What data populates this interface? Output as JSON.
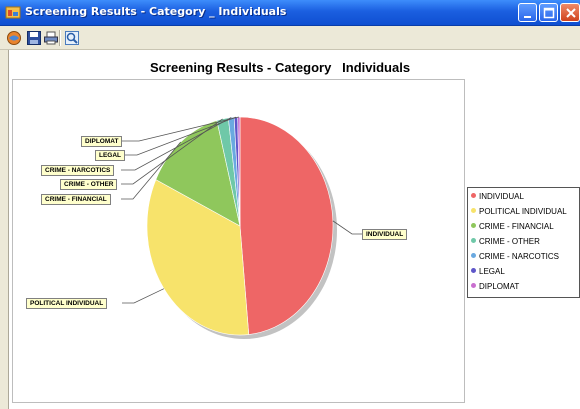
{
  "window": {
    "title": "Screening Results - Category _ Individuals"
  },
  "toolbar": {
    "icons": [
      "globe-icon",
      "save-icon",
      "print-icon",
      "zoom-icon"
    ]
  },
  "chart_data": {
    "type": "pie",
    "title": "Screening Results - Category   Individuals",
    "legend_position": "right",
    "slices": [
      {
        "label": "INDIVIDUAL",
        "value": 48.5,
        "color": "#ee6666"
      },
      {
        "label": "POLITICAL INDIVIDUAL",
        "value": 33.5,
        "color": "#f7e36b"
      },
      {
        "label": "CRIME - FINANCIAL",
        "value": 14.0,
        "color": "#8fc75c"
      },
      {
        "label": "CRIME - OTHER",
        "value": 2.0,
        "color": "#6fc8a8"
      },
      {
        "label": "CRIME - NARCOTICS",
        "value": 1.0,
        "color": "#6aa9e0"
      },
      {
        "label": "LEGAL",
        "value": 0.6,
        "color": "#5e56c9"
      },
      {
        "label": "DIPLOMAT",
        "value": 0.4,
        "color": "#c96fcf"
      }
    ]
  }
}
